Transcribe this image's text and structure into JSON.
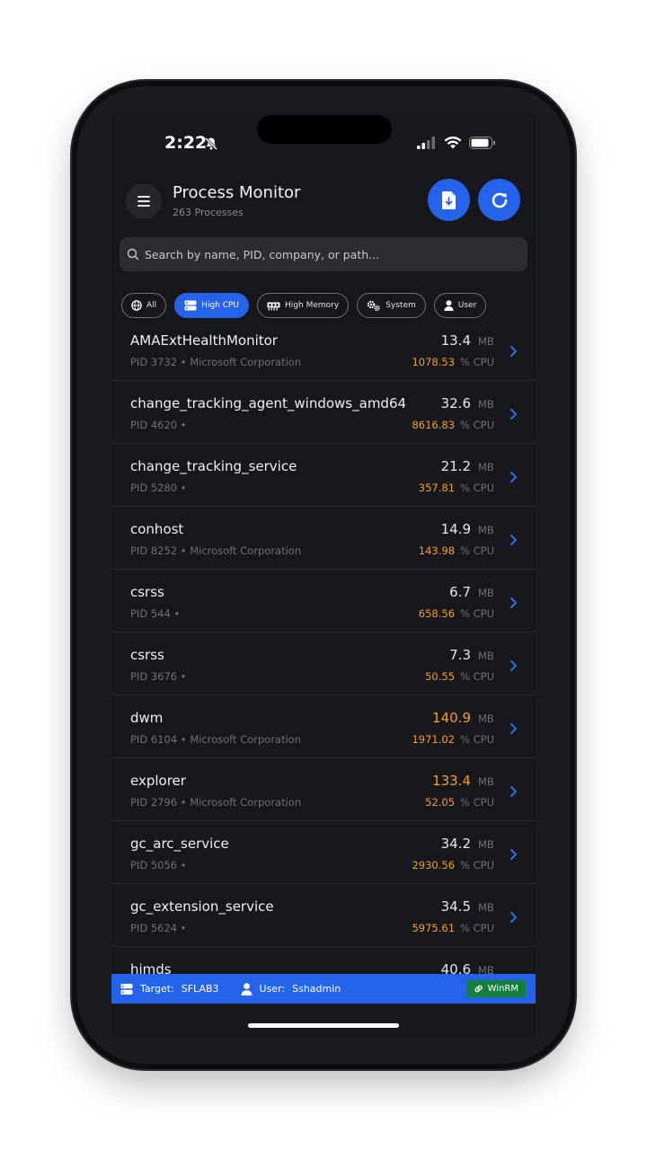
{
  "status": {
    "time": "2:22"
  },
  "header": {
    "title": "Process Monitor",
    "subtitle": "263 Processes"
  },
  "search": {
    "placeholder": "Search by name, PID, company, or path..."
  },
  "filters": [
    {
      "label": "All",
      "icon": "globe-icon",
      "active": false
    },
    {
      "label": "High CPU",
      "icon": "server-icon",
      "active": true
    },
    {
      "label": "High Memory",
      "icon": "memory-icon",
      "active": false
    },
    {
      "label": "System",
      "icon": "gears-icon",
      "active": false
    },
    {
      "label": "User",
      "icon": "user-icon",
      "active": false
    }
  ],
  "processes": [
    {
      "name": "AMAExtHealthMonitor",
      "meta": "PID 3732 • Microsoft Corporation",
      "mem": "13.4",
      "mem_high": false,
      "cpu": "1078.53"
    },
    {
      "name": "change_tracking_agent_windows_amd64",
      "meta": "PID 4620 •",
      "mem": "32.6",
      "mem_high": false,
      "cpu": "8616.83"
    },
    {
      "name": "change_tracking_service",
      "meta": "PID 5280 •",
      "mem": "21.2",
      "mem_high": false,
      "cpu": "357.81"
    },
    {
      "name": "conhost",
      "meta": "PID 8252 • Microsoft Corporation",
      "mem": "14.9",
      "mem_high": false,
      "cpu": "143.98"
    },
    {
      "name": "csrss",
      "meta": "PID 544 •",
      "mem": "6.7",
      "mem_high": false,
      "cpu": "658.56"
    },
    {
      "name": "csrss",
      "meta": "PID 3676 •",
      "mem": "7.3",
      "mem_high": false,
      "cpu": "50.55"
    },
    {
      "name": "dwm",
      "meta": "PID 6104 • Microsoft Corporation",
      "mem": "140.9",
      "mem_high": true,
      "cpu": "1971.02"
    },
    {
      "name": "explorer",
      "meta": "PID 2796 • Microsoft Corporation",
      "mem": "133.4",
      "mem_high": true,
      "cpu": "52.05"
    },
    {
      "name": "gc_arc_service",
      "meta": "PID 5056 •",
      "mem": "34.2",
      "mem_high": false,
      "cpu": "2930.56"
    },
    {
      "name": "gc_extension_service",
      "meta": "PID 5624 •",
      "mem": "34.5",
      "mem_high": false,
      "cpu": "5975.61"
    },
    {
      "name": "himds",
      "meta": "",
      "mem": "40.6",
      "mem_high": false,
      "cpu": ""
    }
  ],
  "units": {
    "mem": "MB",
    "cpu": "% CPU"
  },
  "footer": {
    "target_label": "Target:",
    "target_value": "SFLAB3",
    "user_label": "User:",
    "user_value": "Sshadmin",
    "protocol": "WinRM"
  },
  "colors": {
    "accent": "#2563eb",
    "warning": "#f59e2c",
    "success": "#15803d"
  }
}
